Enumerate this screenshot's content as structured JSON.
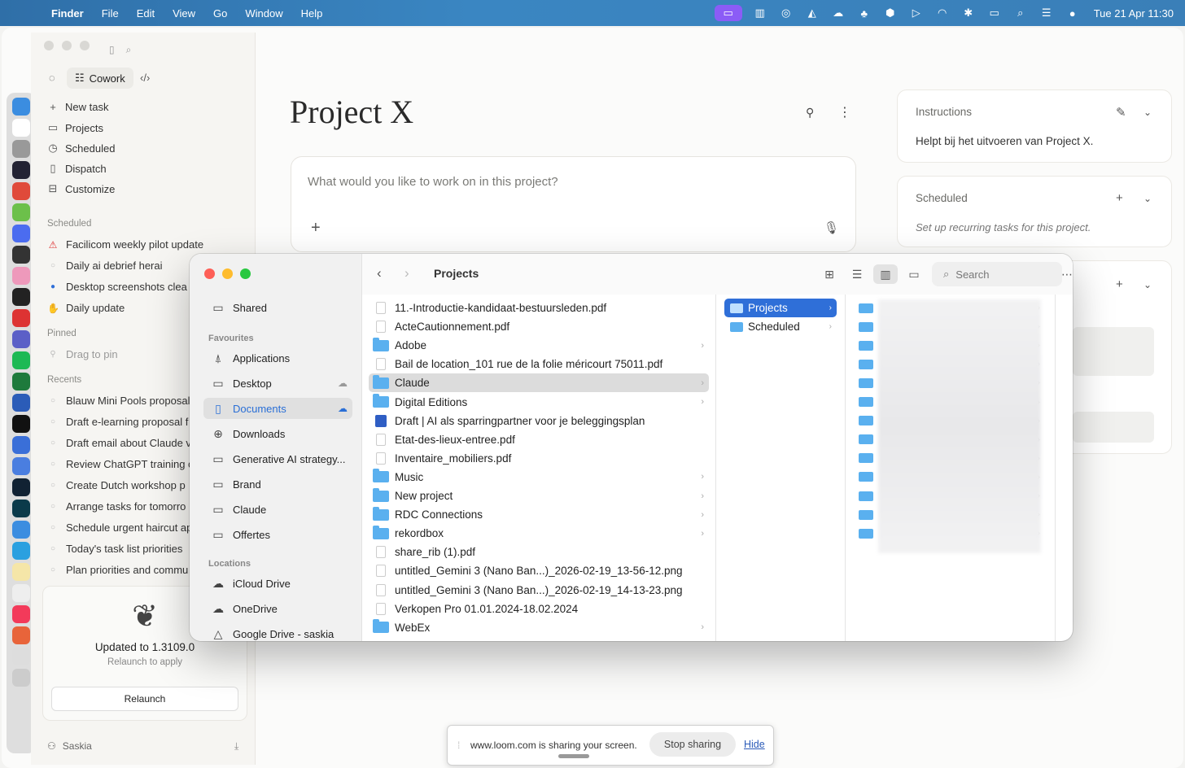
{
  "menubar": {
    "app": "Finder",
    "items": [
      "File",
      "Edit",
      "View",
      "Go",
      "Window",
      "Help"
    ],
    "clock": "Tue 21 Apr  11:30"
  },
  "sidebar": {
    "mode_label": "Cowork",
    "nav": [
      {
        "label": "New task",
        "icon": "plus-icon"
      },
      {
        "label": "Projects",
        "icon": "folder-icon"
      },
      {
        "label": "Scheduled",
        "icon": "clock-icon"
      },
      {
        "label": "Dispatch",
        "icon": "phone-icon"
      },
      {
        "label": "Customize",
        "icon": "briefcase-icon"
      }
    ],
    "scheduled_header": "Scheduled",
    "scheduled": [
      "Facilicom weekly pilot update",
      "Daily ai debrief herai",
      "Desktop screenshots clea",
      "Daily update"
    ],
    "pinned_header": "Pinned",
    "pinned_hint": "Drag to pin",
    "recents_header": "Recents",
    "recents": [
      "Blauw Mini Pools proposal",
      "Draft e-learning proposal f",
      "Draft email about Claude v",
      "Review ChatGPT training c",
      "Create Dutch workshop p",
      "Arrange tasks for tomorro",
      "Schedule urgent haircut ap",
      "Today's task list priorities",
      "Plan priorities and commu"
    ],
    "update": {
      "title": "Updated to 1.3109.0",
      "subtitle": "Relaunch to apply",
      "button": "Relaunch"
    },
    "user": "Saskia"
  },
  "main": {
    "title": "Project X",
    "prompt_placeholder": "What would you like to work on in this project?",
    "instructions": {
      "header": "Instructions",
      "text": "Helpt bij het uitvoeren van Project X."
    },
    "scheduled": {
      "header": "Scheduled",
      "text": "Set up recurring tasks for this project."
    }
  },
  "finder": {
    "title": "Projects",
    "search_placeholder": "Search",
    "sidebar": {
      "shared": "Shared",
      "favourites_header": "Favourites",
      "favourites": [
        "Applications",
        "Desktop",
        "Documents",
        "Downloads",
        "Generative AI strategy...",
        "Brand",
        "Claude",
        "Offertes"
      ],
      "locations_header": "Locations",
      "locations": [
        "iCloud Drive",
        "OneDrive",
        "Google Drive - saskia"
      ]
    },
    "column1": [
      {
        "name": "11.-Introductie-kandidaat-bestuursleden.pdf",
        "kind": "file"
      },
      {
        "name": "ActeCautionnement.pdf",
        "kind": "file"
      },
      {
        "name": "Adobe",
        "kind": "folder"
      },
      {
        "name": "Bail de location_101 rue de la folie méricourt 75011.pdf",
        "kind": "file"
      },
      {
        "name": "Claude",
        "kind": "folder",
        "selected": true
      },
      {
        "name": "Digital Editions",
        "kind": "folder"
      },
      {
        "name": "Draft | AI als sparringpartner voor je beleggingsplan",
        "kind": "doc"
      },
      {
        "name": "Etat-des-lieux-entree.pdf",
        "kind": "file"
      },
      {
        "name": "Inventaire_mobiliers.pdf",
        "kind": "file"
      },
      {
        "name": "Music",
        "kind": "folder"
      },
      {
        "name": "New project",
        "kind": "folder"
      },
      {
        "name": "RDC Connections",
        "kind": "folder"
      },
      {
        "name": "rekordbox",
        "kind": "folder"
      },
      {
        "name": "share_rib (1).pdf",
        "kind": "file"
      },
      {
        "name": "untitled_Gemini 3 (Nano Ban...)_2026-02-19_13-56-12.png",
        "kind": "file"
      },
      {
        "name": "untitled_Gemini 3 (Nano Ban...)_2026-02-19_14-13-23.png",
        "kind": "file"
      },
      {
        "name": "Verkopen Pro 01.01.2024-18.02.2024",
        "kind": "file"
      },
      {
        "name": "WebEx",
        "kind": "folder"
      }
    ],
    "column2": [
      {
        "name": "Projects",
        "selected": true
      },
      {
        "name": "Scheduled"
      }
    ],
    "column3_count": 13
  },
  "loom": {
    "message": "www.loom.com is sharing your screen.",
    "stop": "Stop sharing",
    "hide": "Hide"
  }
}
